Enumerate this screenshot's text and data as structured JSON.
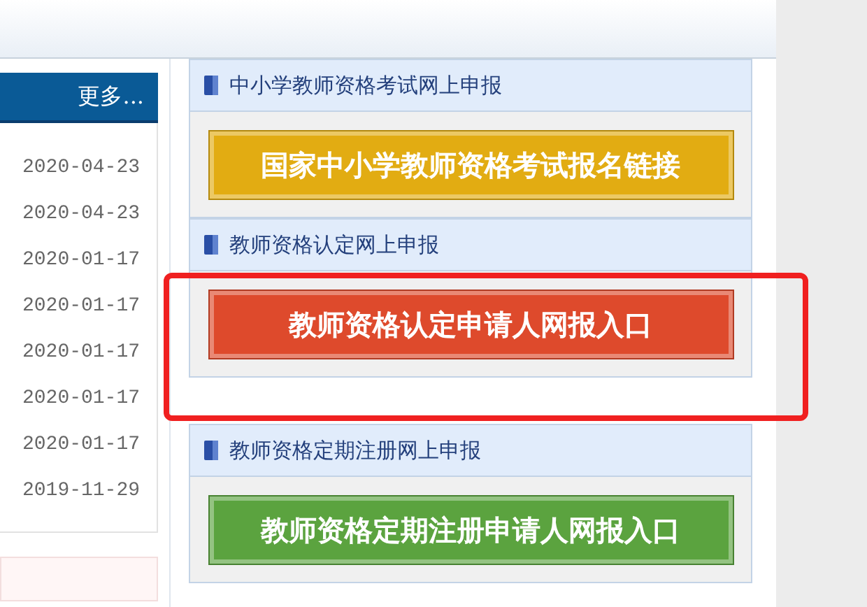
{
  "news": {
    "more_link": "更多...",
    "dates": [
      "2020-04-23",
      "2020-04-23",
      "2020-01-17",
      "2020-01-17",
      "2020-01-17",
      "2020-01-17",
      "2020-01-17",
      "2019-11-29"
    ]
  },
  "sections": [
    {
      "title": "中小学教师资格考试网上申报",
      "button": "国家中小学教师资格考试报名链接",
      "color": "#e2ac12",
      "highlighted": false
    },
    {
      "title": "教师资格认定网上申报",
      "button": "教师资格认定申请人网报入口",
      "color": "#de4a2c",
      "highlighted": true
    },
    {
      "title": "教师资格定期注册网上申报",
      "button": "教师资格定期注册申请人网报入口",
      "color": "#5ba33f",
      "highlighted": false
    }
  ]
}
